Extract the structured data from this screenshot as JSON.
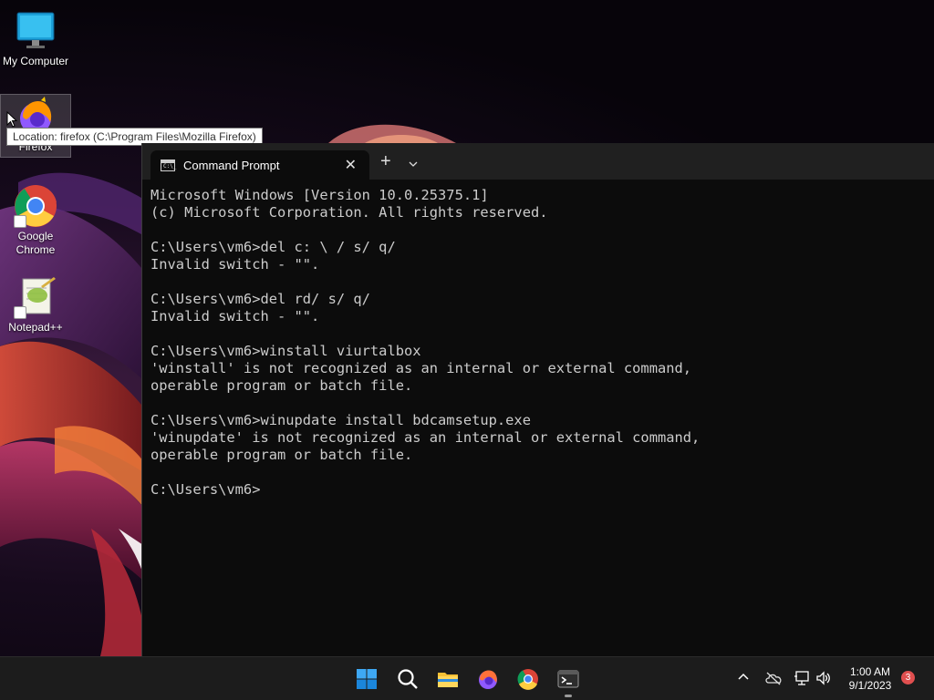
{
  "desktop": {
    "icons": [
      {
        "label": "My Computer"
      },
      {
        "label": "Firefox"
      },
      {
        "label": "Google Chrome"
      },
      {
        "label": "Notepad++"
      }
    ],
    "tooltip": "Location: firefox (C:\\Program Files\\Mozilla Firefox)"
  },
  "terminal": {
    "tab_title": "Command Prompt",
    "tab_icon_text": "C:\\_",
    "close_glyph": "✕",
    "new_tab_glyph": "+",
    "dropdown_glyph": "⌄",
    "output": "Microsoft Windows [Version 10.0.25375.1]\n(c) Microsoft Corporation. All rights reserved.\n\nC:\\Users\\vm6>del c: \\ / s/ q/\nInvalid switch - \"\".\n\nC:\\Users\\vm6>del rd/ s/ q/\nInvalid switch - \"\".\n\nC:\\Users\\vm6>winstall viurtalbox\n'winstall' is not recognized as an internal or external command,\noperable program or batch file.\n\nC:\\Users\\vm6>winupdate install bdcamsetup.exe\n'winupdate' is not recognized as an internal or external command,\noperable program or batch file.\n\nC:\\Users\\vm6>"
  },
  "taskbar": {
    "apps": [
      "start-icon",
      "search-icon",
      "file-explorer-icon",
      "firefox-icon",
      "chrome-icon",
      "terminal-icon"
    ],
    "tray": {
      "chevron_glyph": "^",
      "time": "1:00 AM",
      "date": "9/1/2023",
      "notification_count": "3"
    }
  },
  "colors": {
    "terminal_bg": "#0c0c0c",
    "titlebar_bg": "#202020",
    "taskbar_bg": "#1c1c1c",
    "badge": "#e04f4f"
  }
}
